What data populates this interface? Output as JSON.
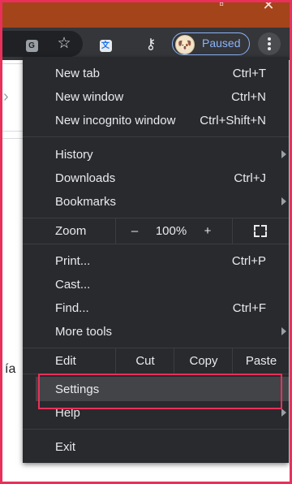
{
  "toolbar": {
    "profile_status": "Paused",
    "icons": [
      "translate-icon",
      "star-icon",
      "translate-extension-icon",
      "key-icon",
      "avatar",
      "more-menu-icon"
    ]
  },
  "page": {
    "partial_text": "ía"
  },
  "menu": {
    "new_tab": {
      "label": "New tab",
      "shortcut": "Ctrl+T"
    },
    "new_window": {
      "label": "New window",
      "shortcut": "Ctrl+N"
    },
    "new_incognito": {
      "label": "New incognito window",
      "shortcut": "Ctrl+Shift+N"
    },
    "history": {
      "label": "History"
    },
    "downloads": {
      "label": "Downloads",
      "shortcut": "Ctrl+J"
    },
    "bookmarks": {
      "label": "Bookmarks"
    },
    "zoom": {
      "label": "Zoom",
      "minus": "–",
      "value": "100%",
      "plus": "+"
    },
    "print": {
      "label": "Print...",
      "shortcut": "Ctrl+P"
    },
    "cast": {
      "label": "Cast..."
    },
    "find": {
      "label": "Find...",
      "shortcut": "Ctrl+F"
    },
    "more_tools": {
      "label": "More tools"
    },
    "edit": {
      "label": "Edit",
      "cut": "Cut",
      "copy": "Copy",
      "paste": "Paste"
    },
    "settings": {
      "label": "Settings"
    },
    "help": {
      "label": "Help"
    },
    "exit": {
      "label": "Exit"
    }
  },
  "colors": {
    "titlebar": "#a4441a",
    "menu_bg": "#292a2d",
    "highlight_box": "#e8305a",
    "profile_accent": "#8ab4f8"
  }
}
